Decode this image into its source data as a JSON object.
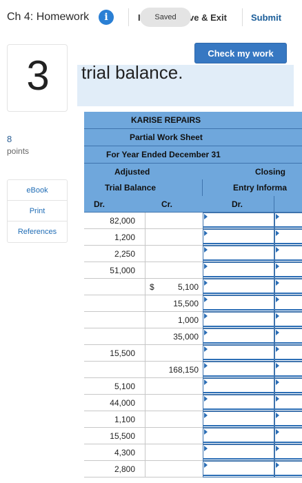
{
  "header": {
    "title": "Ch 4: Homework",
    "hidden_fragment": "I",
    "saved_label": "Saved",
    "save_exit_label": "ve & Exit",
    "submit_label": "Submit",
    "info_glyph": "i"
  },
  "question": {
    "number": "3",
    "points_value": "8",
    "points_label": "points"
  },
  "side_links": [
    "eBook",
    "Print",
    "References"
  ],
  "check_button_label": "Check my work",
  "instruction_fragment": "trial balance.",
  "worksheet": {
    "company": "KARISE REPAIRS",
    "sheet_title": "Partial Work Sheet",
    "period": "For Year Ended December 31",
    "adjusted_label": "Adjusted",
    "closing_label": "Closing",
    "trial_balance_label": "Trial Balance",
    "entry_info_label": "Entry Informa",
    "dr_label": "Dr.",
    "cr_label": "Cr.",
    "dr_label_2": "Dr.",
    "currency": "$",
    "rows": [
      {
        "dr": "82,000",
        "cr": ""
      },
      {
        "dr": "1,200",
        "cr": ""
      },
      {
        "dr": "2,250",
        "cr": ""
      },
      {
        "dr": "51,000",
        "cr": ""
      },
      {
        "dr": "",
        "cr": "5,100",
        "currency": true
      },
      {
        "dr": "",
        "cr": "15,500"
      },
      {
        "dr": "",
        "cr": "1,000"
      },
      {
        "dr": "",
        "cr": "35,000"
      },
      {
        "dr": "15,500",
        "cr": ""
      },
      {
        "dr": "",
        "cr": "168,150"
      },
      {
        "dr": "5,100",
        "cr": ""
      },
      {
        "dr": "44,000",
        "cr": ""
      },
      {
        "dr": "1,100",
        "cr": ""
      },
      {
        "dr": "15,500",
        "cr": ""
      },
      {
        "dr": "4,300",
        "cr": ""
      },
      {
        "dr": "2,800",
        "cr": ""
      }
    ]
  },
  "colors": {
    "header_band": "#6fa7dc",
    "accent_blue": "#3778c2",
    "link_blue": "#1f6cb5",
    "info_blue": "#2a7fd4",
    "instruction_bg": "#e1edf8"
  }
}
